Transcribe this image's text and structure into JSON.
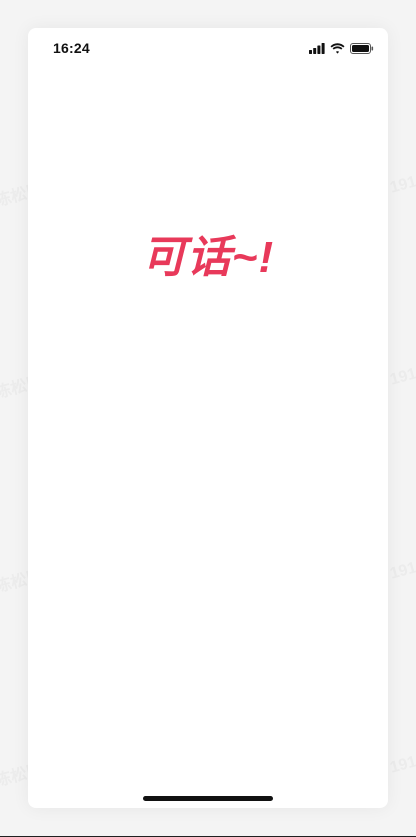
{
  "status_bar": {
    "time": "16:24",
    "signal_icon": "cellular-signal-icon",
    "wifi_icon": "wifi-icon",
    "battery_icon": "battery-icon"
  },
  "app": {
    "brand_text": "可话~!",
    "brand_color": "#e8395a"
  },
  "watermark": {
    "text": "陈松民 1914",
    "color": "#ececec"
  }
}
